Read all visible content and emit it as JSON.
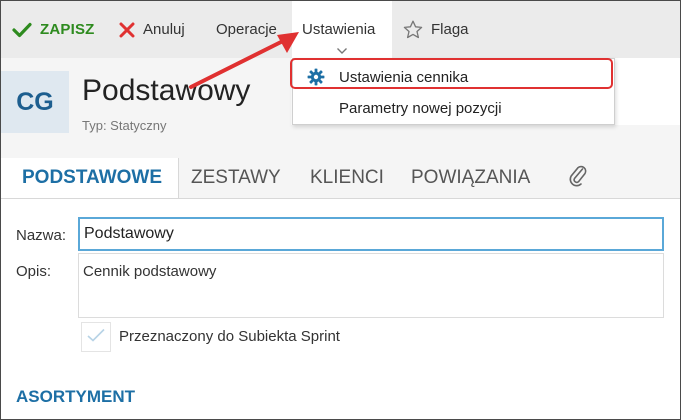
{
  "toolbar": {
    "save_label": "ZAPISZ",
    "cancel_label": "Anuluj",
    "operations_label": "Operacje",
    "settings_label": "Ustawienia",
    "flag_label": "Flaga"
  },
  "dropdown": {
    "items": [
      {
        "label": "Ustawienia cennika",
        "icon": "gear-icon"
      },
      {
        "label": "Parametry nowej pozycji",
        "icon": ""
      }
    ]
  },
  "header": {
    "avatar": "CG",
    "title": "Podstawowy",
    "subtitle": "Typ: Statyczny"
  },
  "tabs": [
    {
      "label": "PODSTAWOWE",
      "active": true
    },
    {
      "label": "ZESTAWY"
    },
    {
      "label": "KLIENCI"
    },
    {
      "label": "POWIĄZANIA"
    },
    {
      "label": "",
      "icon": "paperclip-icon"
    }
  ],
  "form": {
    "name_label": "Nazwa:",
    "name_value": "Podstawowy",
    "desc_label": "Opis:",
    "desc_value": "Cennik podstawowy",
    "checkbox_label": "Przeznaczony do Subiekta Sprint",
    "checkbox_checked": true
  },
  "section_title": "ASORTYMENT",
  "colors": {
    "accent": "#1d6fa5",
    "save": "#2e8b1f",
    "cancel": "#e03131",
    "highlight": "#e03131"
  }
}
